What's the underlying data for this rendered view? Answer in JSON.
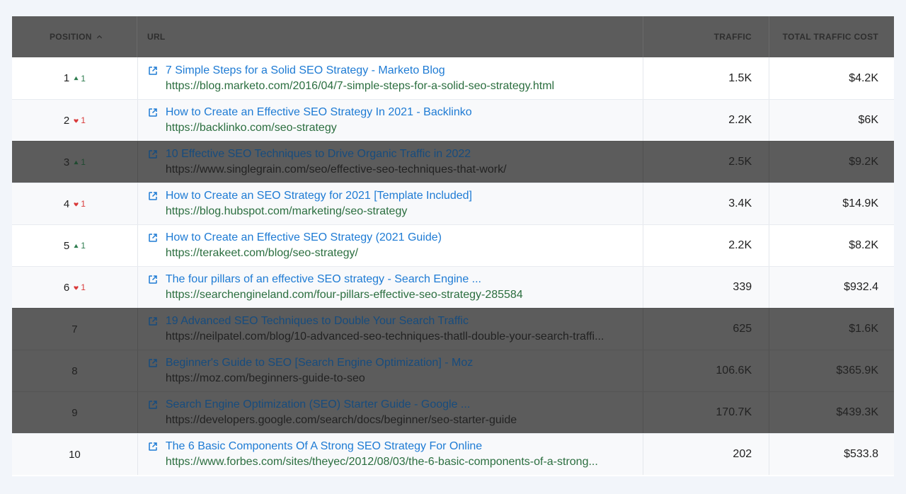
{
  "colors": {
    "title_link": "#1e7bd4",
    "url_text": "#2b6e3f",
    "delta_up": "#2e7d4f",
    "delta_down": "#d93a3a",
    "header_bg": "#5c5c5c",
    "page_bg": "#f2f5fa"
  },
  "header": {
    "position": "POSITION",
    "url": "URL",
    "traffic": "TRAFFIC",
    "cost": "TOTAL TRAFFIC COST",
    "sort_icon": "chevron-up-icon"
  },
  "rows": [
    {
      "position": "1",
      "delta": "1",
      "delta_dir": "up",
      "title": "7 Simple Steps for a Solid SEO Strategy - Marketo Blog",
      "url": "https://blog.marketo.com/2016/04/7-simple-steps-for-a-solid-seo-strategy.html",
      "traffic": "1.5K",
      "cost": "$4.2K",
      "dimmed": false
    },
    {
      "position": "2",
      "delta": "1",
      "delta_dir": "down",
      "title": "How to Create an Effective SEO Strategy In 2021 - Backlinko",
      "url": "https://backlinko.com/seo-strategy",
      "traffic": "2.2K",
      "cost": "$6K",
      "dimmed": false
    },
    {
      "position": "3",
      "delta": "1",
      "delta_dir": "up",
      "title": "10 Effective SEO Techniques to Drive Organic Traffic in 2022",
      "url": "https://www.singlegrain.com/seo/effective-seo-techniques-that-work/",
      "traffic": "2.5K",
      "cost": "$9.2K",
      "dimmed": true
    },
    {
      "position": "4",
      "delta": "1",
      "delta_dir": "down",
      "title": "How to Create an SEO Strategy for 2021 [Template Included]",
      "url": "https://blog.hubspot.com/marketing/seo-strategy",
      "traffic": "3.4K",
      "cost": "$14.9K",
      "dimmed": false
    },
    {
      "position": "5",
      "delta": "1",
      "delta_dir": "up",
      "title": "How to Create an Effective SEO Strategy (2021 Guide)",
      "url": "https://terakeet.com/blog/seo-strategy/",
      "traffic": "2.2K",
      "cost": "$8.2K",
      "dimmed": false
    },
    {
      "position": "6",
      "delta": "1",
      "delta_dir": "down",
      "title": "The four pillars of an effective SEO strategy - Search Engine ...",
      "url": "https://searchengineland.com/four-pillars-effective-seo-strategy-285584",
      "traffic": "339",
      "cost": "$932.4",
      "dimmed": false
    },
    {
      "position": "7",
      "delta": "",
      "delta_dir": "",
      "title": "19 Advanced SEO Techniques to Double Your Search Traffic",
      "url": "https://neilpatel.com/blog/10-advanced-seo-techniques-thatll-double-your-search-traffi...",
      "traffic": "625",
      "cost": "$1.6K",
      "dimmed": true
    },
    {
      "position": "8",
      "delta": "",
      "delta_dir": "",
      "title": "Beginner's Guide to SEO [Search Engine Optimization] - Moz",
      "url": "https://moz.com/beginners-guide-to-seo",
      "traffic": "106.6K",
      "cost": "$365.9K",
      "dimmed": true
    },
    {
      "position": "9",
      "delta": "",
      "delta_dir": "",
      "title": "Search Engine Optimization (SEO) Starter Guide - Google ...",
      "url": "https://developers.google.com/search/docs/beginner/seo-starter-guide",
      "traffic": "170.7K",
      "cost": "$439.3K",
      "dimmed": true
    },
    {
      "position": "10",
      "delta": "",
      "delta_dir": "",
      "title": "The 6 Basic Components Of A Strong SEO Strategy For Online",
      "url": "https://www.forbes.com/sites/theyec/2012/08/03/the-6-basic-components-of-a-strong...",
      "traffic": "202",
      "cost": "$533.8",
      "dimmed": false
    }
  ]
}
